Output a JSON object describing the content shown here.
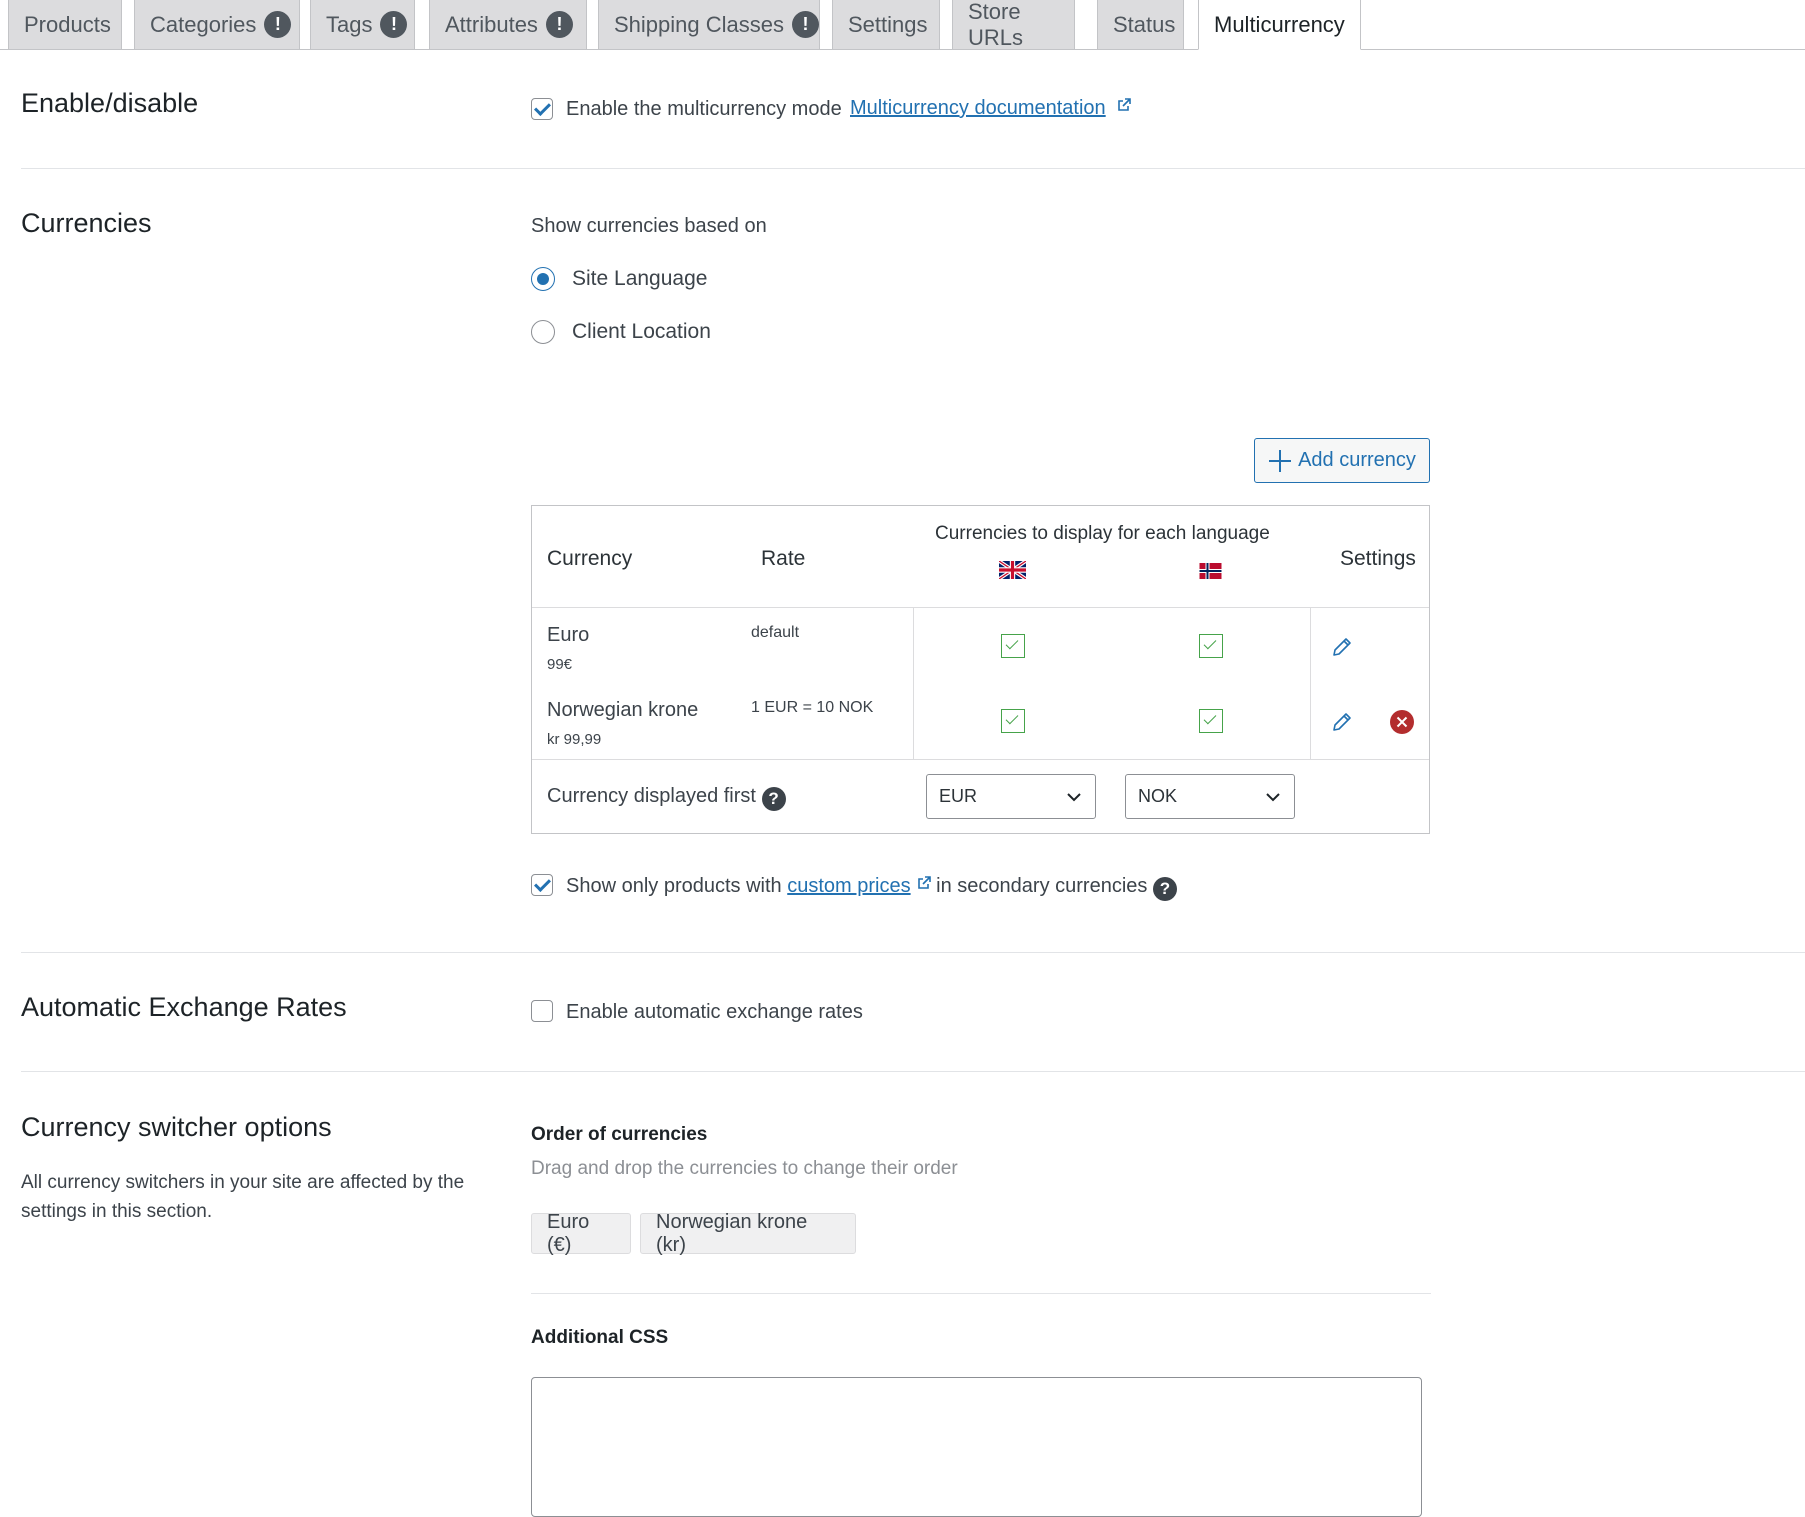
{
  "tabs": [
    {
      "label": "Products",
      "badge": ""
    },
    {
      "label": "Categories",
      "badge": "!"
    },
    {
      "label": "Tags",
      "badge": "!"
    },
    {
      "label": "Attributes",
      "badge": "!"
    },
    {
      "label": "Shipping Classes",
      "badge": "!"
    },
    {
      "label": "Settings",
      "badge": ""
    },
    {
      "label": "Store URLs",
      "badge": ""
    },
    {
      "label": "Status",
      "badge": ""
    },
    {
      "label": "Multicurrency",
      "badge": "",
      "active": true
    }
  ],
  "enable": {
    "title": "Enable/disable",
    "checkbox_label": "Enable the multicurrency mode",
    "checked": true,
    "doc_link": "Multicurrency documentation"
  },
  "currencies": {
    "title": "Currencies",
    "show_based_on": "Show currencies based on",
    "options": [
      {
        "label": "Site Language",
        "selected": true
      },
      {
        "label": "Client Location",
        "selected": false
      }
    ],
    "add_button": "Add currency",
    "table": {
      "headers": {
        "currency": "Currency",
        "rate": "Rate",
        "per_language": "Currencies to display for each language",
        "settings": "Settings"
      },
      "flags": [
        "uk-flag",
        "norway-flag"
      ],
      "rows": [
        {
          "name": "Euro",
          "price": "99€",
          "rate": "default",
          "lang1": true,
          "lang2": true,
          "removable": false
        },
        {
          "name": "Norwegian krone",
          "price": "kr 99,99",
          "rate": "1 EUR = 10 NOK",
          "lang1": true,
          "lang2": true,
          "removable": true
        }
      ],
      "displayed_first_label": "Currency displayed first",
      "displayed_first_values": [
        "EUR",
        "NOK"
      ]
    },
    "show_only": {
      "before": "Show only products with",
      "link": "custom prices",
      "after": "in secondary currencies",
      "checked": true
    }
  },
  "auto_rates": {
    "title": "Automatic Exchange Rates",
    "checkbox_label": "Enable automatic exchange rates",
    "checked": false
  },
  "switcher": {
    "title": "Currency switcher options",
    "description_line1": "All currency switchers in your site are affected by the",
    "description_line2": "settings in this section.",
    "order_title": "Order of currencies",
    "order_hint": "Drag and drop the currencies to change their order",
    "order_items": [
      "Euro (€)",
      "Norwegian krone (kr)"
    ],
    "css_title": "Additional CSS",
    "css_value": ""
  },
  "colors": {
    "accent": "#2271b1",
    "check_green": "#46a34a",
    "delete_red": "#b32d2e",
    "tab_bg": "#dcdcde"
  }
}
